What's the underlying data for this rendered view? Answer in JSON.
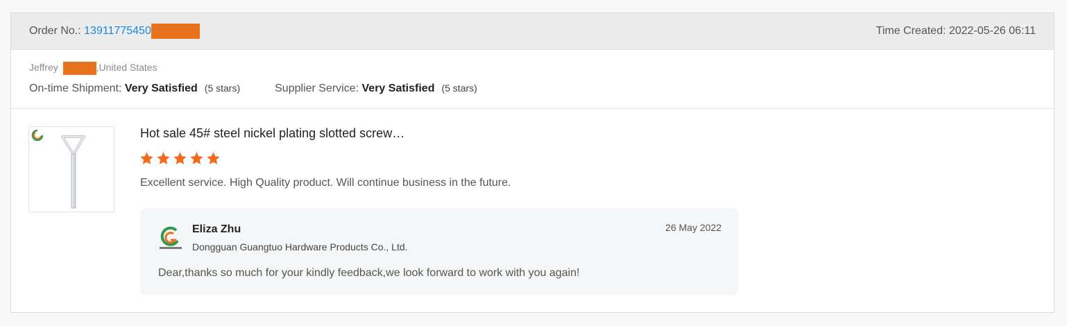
{
  "order": {
    "label": "Order No.: ",
    "number": "13911775450",
    "time_created": "Time Created: 2022-05-26 06:11"
  },
  "buyer": {
    "first_name": "Jeffrey",
    "location": ",United States"
  },
  "ratings": {
    "shipment_label": "On-time Shipment: ",
    "shipment_value": "Very Satisfied",
    "shipment_stars": "(5 stars)",
    "service_label": "Supplier Service: ",
    "service_value": "Very Satisfied",
    "service_stars": "(5 stars)"
  },
  "product": {
    "title": "Hot sale 45# steel nickel plating slotted screw…",
    "star_rating": 5,
    "star_max": 5,
    "review_text": "Excellent service. High Quality product. Will continue business in the future."
  },
  "reply": {
    "name": "Eliza Zhu",
    "date": "26 May 2022",
    "company": "Dongguan Guangtuo Hardware Products Co., Ltd.",
    "message": "Dear,thanks so much for your kindly feedback,we look forward to work with you again!"
  },
  "colors": {
    "accent": "#1a88d6",
    "star": "#f26b1d",
    "redaction": "#e8731f"
  },
  "icons": [
    "product-thumbnail",
    "supplier-logo",
    "star-icon"
  ]
}
